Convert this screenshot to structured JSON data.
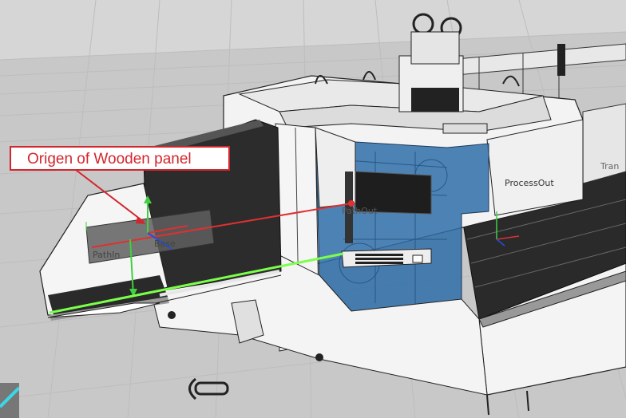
{
  "annotation": {
    "text": "Origen of Wooden panel",
    "color": "#d3262c"
  },
  "frames": {
    "pathin": "PathIn",
    "base": "Base",
    "pathout": "PathOut",
    "processout": "ProcessOut",
    "partial_right": "Tran"
  },
  "colors": {
    "floor": "#c9c9c9",
    "grid_line": "#b8b8b8",
    "enclosure_blue": "#2f6fa8",
    "machine_dark": "#2b2b2b",
    "machine_white": "#f2f2f2",
    "axis_x": "#e03030",
    "axis_y": "#40d040",
    "axis_z": "#2050e0"
  },
  "icons": {
    "corner": "corner-handle-icon"
  }
}
